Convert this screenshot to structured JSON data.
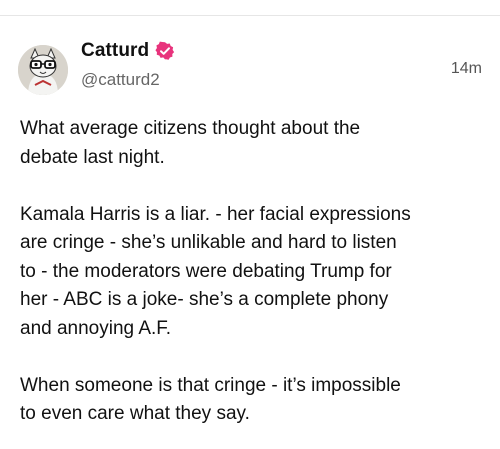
{
  "post": {
    "author": {
      "display_name": "Catturd",
      "handle": "@catturd2",
      "verified": true,
      "verified_color": "#e8337c",
      "avatar_icon": "cartoon-cat-with-glasses-avatar"
    },
    "timestamp": "14m",
    "paragraphs": [
      "What average citizens thought about the\ndebate last night.",
      "Kamala Harris is a liar. - her facial expressions\nare cringe - she’s unlikable and hard to listen\nto - the moderators were debating Trump for\nher - ABC is a joke- she’s a complete phony\nand annoying A.F.",
      "When someone is that cringe - it’s impossible\nto even care what they say."
    ]
  }
}
